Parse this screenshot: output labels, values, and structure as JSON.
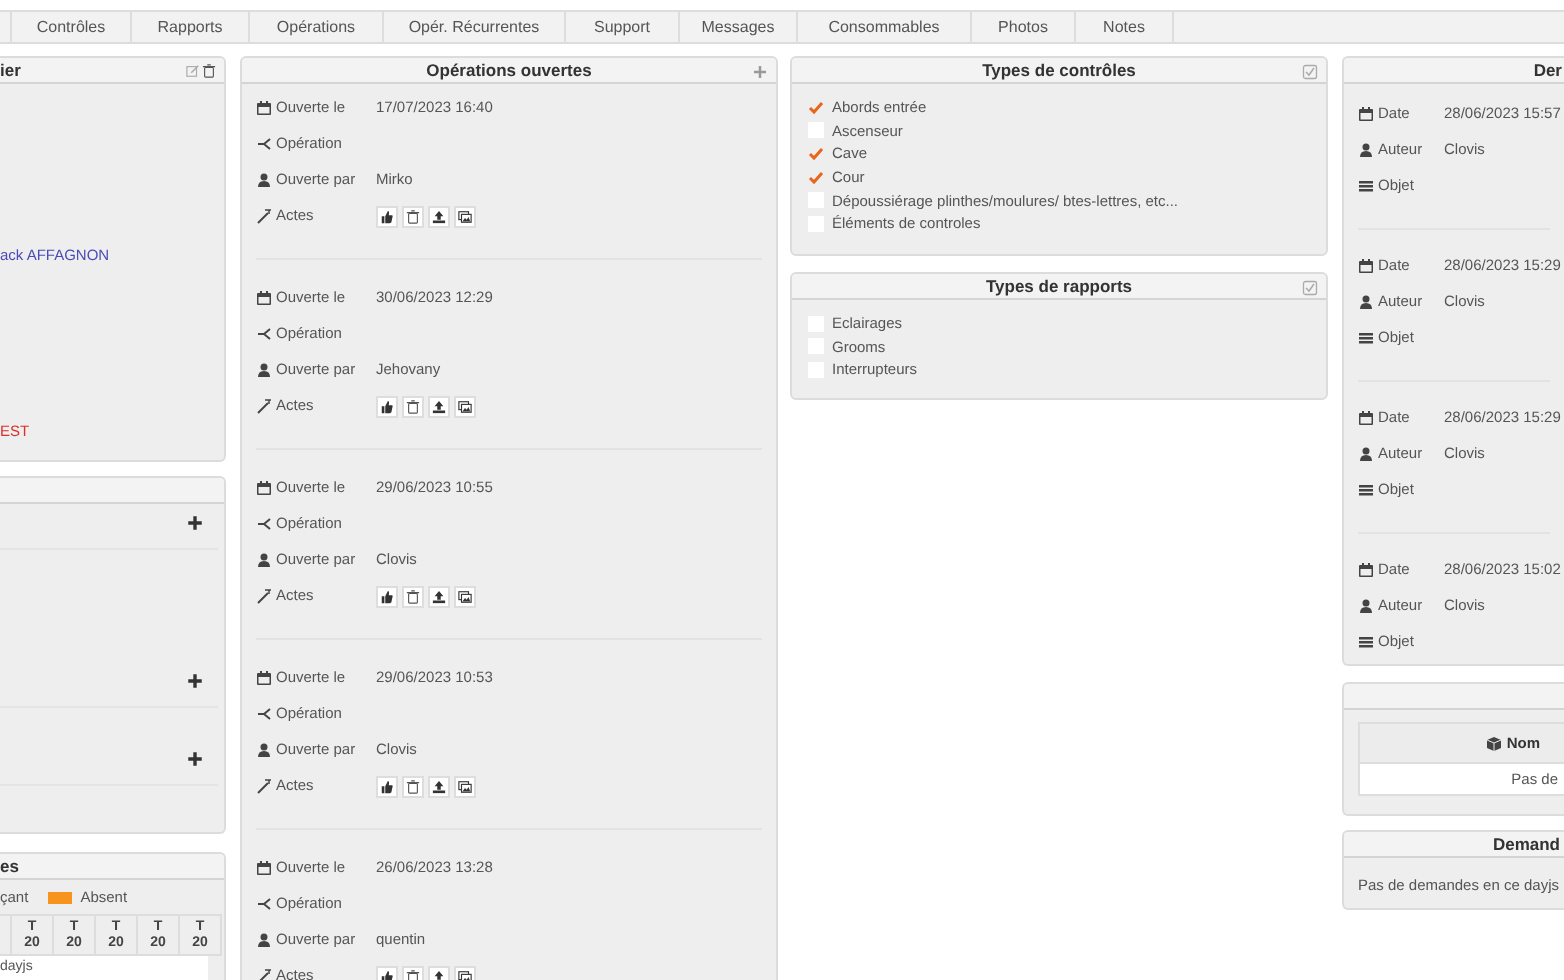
{
  "tabs": [
    {
      "label": "Contrôles",
      "selected": false
    },
    {
      "label": "Rapports",
      "selected": false
    },
    {
      "label": "Opérations",
      "selected": false
    },
    {
      "label": "Opér. Récurrentes",
      "selected": false
    },
    {
      "label": "Support",
      "selected": false
    },
    {
      "label": "Messages",
      "selected": false
    },
    {
      "label": "Consommables",
      "selected": false
    },
    {
      "label": "Photos",
      "selected": false
    },
    {
      "label": "Notes",
      "selected": false
    }
  ],
  "info_panel": {
    "title": "ier",
    "lines": [
      {
        "text": "ack AFFAGNON",
        "kind": "link"
      },
      {
        "text": "EST",
        "kind": "alert"
      }
    ]
  },
  "presence_panel": {
    "title": "es",
    "legend": [
      {
        "label": "çant"
      },
      {
        "label": "Absent",
        "color": "#f7941d"
      }
    ],
    "days": [
      {
        "letter": "T",
        "number": "20"
      },
      {
        "letter": "T",
        "number": "20"
      },
      {
        "letter": "T",
        "number": "20"
      },
      {
        "letter": "T",
        "number": "20"
      },
      {
        "letter": "T",
        "number": "20"
      }
    ],
    "note": "dayjs"
  },
  "open_operations": {
    "title": "Opérations ouvertes",
    "records": [
      {
        "opened_label": "Ouverte le",
        "opened": "17/07/2023 16:40",
        "operation_label": "Opération",
        "by_label": "Ouverte par",
        "by": "Mirko",
        "acts_label": "Actes"
      },
      {
        "opened_label": "Ouverte le",
        "opened": "30/06/2023 12:29",
        "operation_label": "Opération",
        "by_label": "Ouverte par",
        "by": "Jehovany",
        "acts_label": "Actes"
      },
      {
        "opened_label": "Ouverte le",
        "opened": "29/06/2023 10:55",
        "operation_label": "Opération",
        "by_label": "Ouverte par",
        "by": "Clovis",
        "acts_label": "Actes"
      },
      {
        "opened_label": "Ouverte le",
        "opened": "29/06/2023 10:53",
        "operation_label": "Opération",
        "by_label": "Ouverte par",
        "by": "Clovis",
        "acts_label": "Actes"
      },
      {
        "opened_label": "Ouverte le",
        "opened": "26/06/2023 13:28",
        "operation_label": "Opération",
        "by_label": "Ouverte par",
        "by": "quentin",
        "acts_label": "Actes"
      }
    ]
  },
  "control_types": {
    "title": "Types de contrôles",
    "items": [
      {
        "label": "Abords entrée",
        "checked": true
      },
      {
        "label": "Ascenseur",
        "checked": false
      },
      {
        "label": "Cave",
        "checked": true
      },
      {
        "label": "Cour",
        "checked": true
      },
      {
        "label": "Dépoussiérage plinthes/moulures/ btes-lettres, etc...",
        "checked": false
      },
      {
        "label": "Éléments de controles",
        "checked": false
      }
    ]
  },
  "report_types": {
    "title": "Types de rapports",
    "items": [
      {
        "label": "Eclairages",
        "checked": false
      },
      {
        "label": "Grooms",
        "checked": false
      },
      {
        "label": "Interrupteurs",
        "checked": false
      }
    ]
  },
  "latest_panel": {
    "title": "Der",
    "records": [
      {
        "date_label": "Date",
        "date": "28/06/2023 15:57",
        "author_label": "Auteur",
        "author": "Clovis",
        "object_label": "Objet"
      },
      {
        "date_label": "Date",
        "date": "28/06/2023 15:29",
        "author_label": "Auteur",
        "author": "Clovis",
        "object_label": "Objet"
      },
      {
        "date_label": "Date",
        "date": "28/06/2023 15:29",
        "author_label": "Auteur",
        "author": "Clovis",
        "object_label": "Objet"
      },
      {
        "date_label": "Date",
        "date": "28/06/2023 15:02",
        "author_label": "Auteur",
        "author": "Clovis",
        "object_label": "Objet"
      }
    ]
  },
  "items_table": {
    "column": "Nom",
    "empty": "Pas de"
  },
  "requests_panel": {
    "title": "Demand",
    "empty": "Pas de demandes en ce dayjs"
  }
}
